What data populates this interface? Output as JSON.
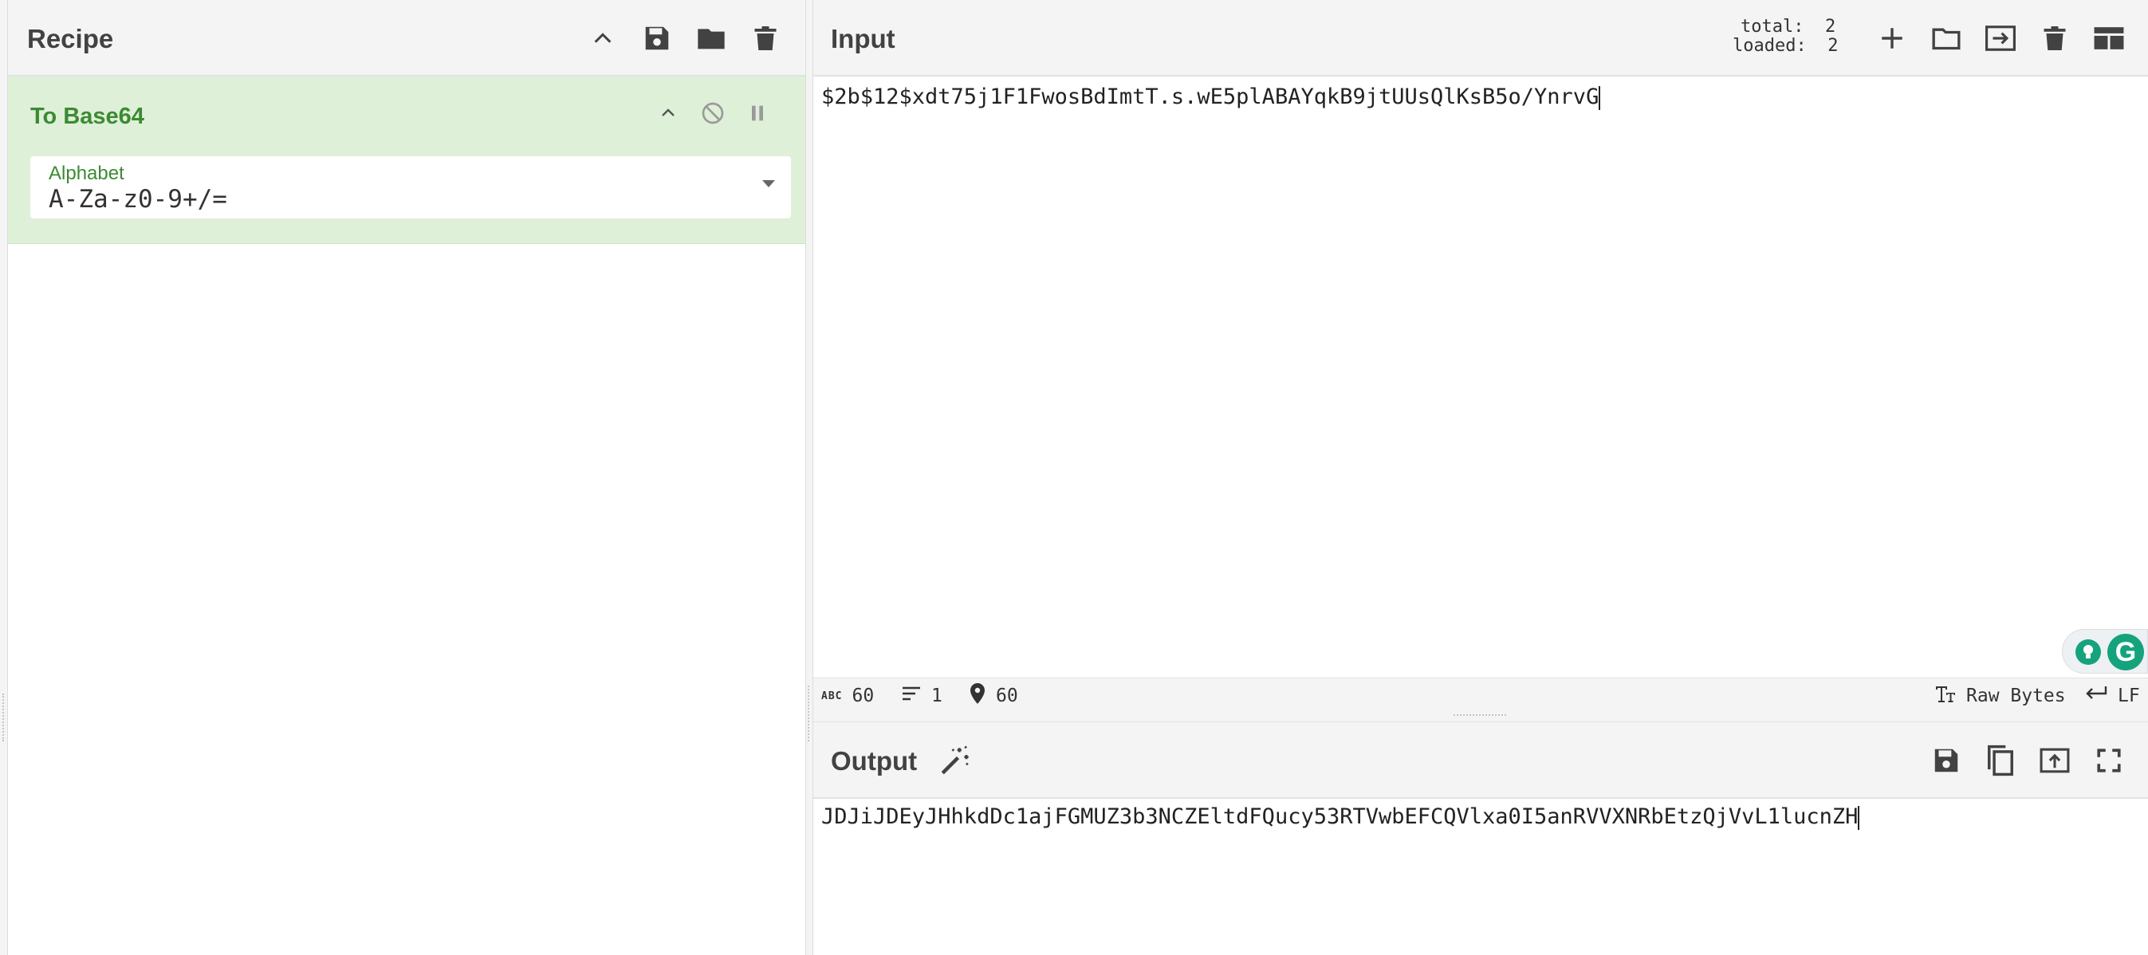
{
  "recipe": {
    "title": "Recipe",
    "operation": {
      "name": "To Base64",
      "field_label": "Alphabet",
      "field_value": "A-Za-z0-9+/="
    }
  },
  "input": {
    "title": "Input",
    "total_label": "total:",
    "total_value": "2",
    "loaded_label": "loaded:",
    "loaded_value": "2",
    "text": "$2b$12$xdt75j1F1FwosBdImtT.s.wE5plABAYqkB9jtUUsQlKsB5o/YnrvG",
    "status": {
      "length_label": "ABC",
      "length": "60",
      "lines": "1",
      "position": "60",
      "encoding": "Raw Bytes",
      "eol": "LF"
    }
  },
  "output": {
    "title": "Output",
    "text": "JDJiJDEyJHhkdDc1ajFGMUZ3b3NCZEltdFQucy53RTVwbEFCQVlxa0I5anRVVXNRbEtzQjVvL1lucnZH"
  },
  "colors": {
    "accent_green": "#3c8a33",
    "operation_bg": "#dff0d8",
    "header_bg": "#f4f4f4",
    "grammarly_green": "#15a37d"
  },
  "icons": {
    "collapse": "chevron-up-icon",
    "save": "save-icon",
    "folder": "folder-icon",
    "trash": "trash-icon",
    "disable": "disable-icon",
    "pause": "pause-icon",
    "add": "plus-icon",
    "swap": "swap-icon",
    "layout": "layout-icon",
    "magic": "magic-wand-icon",
    "copy": "copy-icon",
    "replace": "replace-input-icon",
    "fullscreen": "fullscreen-icon"
  }
}
